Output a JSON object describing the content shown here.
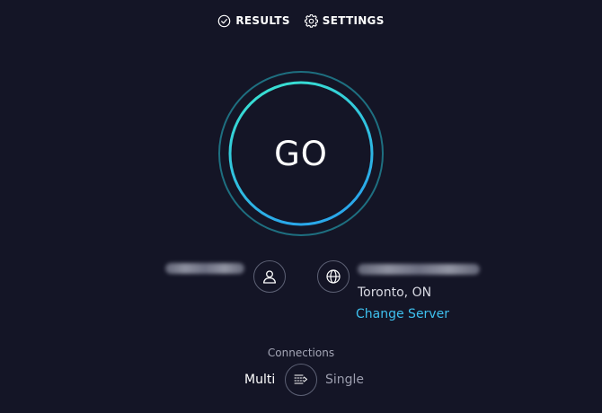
{
  "nav": {
    "results_label": "RESULTS",
    "settings_label": "SETTINGS"
  },
  "go": {
    "label": "GO"
  },
  "isp": {
    "host_name": "",
    "location": "Toronto, ON",
    "change_server_label": "Change Server"
  },
  "connections": {
    "title": "Connections",
    "multi_label": "Multi",
    "single_label": "Single",
    "selected": "Multi"
  },
  "icons": {
    "results": "check-circle-icon",
    "settings": "gear-icon",
    "user": "user-icon",
    "server": "globe-icon",
    "connections": "connections-toggle-icon"
  },
  "colors": {
    "background": "#141526",
    "ring_outer": "#1e6f80",
    "ring_inner_start": "#3ae6cf",
    "ring_inner_end": "#2aa8ea",
    "link": "#3ec0ee",
    "muted_text": "#a4a6b6"
  }
}
